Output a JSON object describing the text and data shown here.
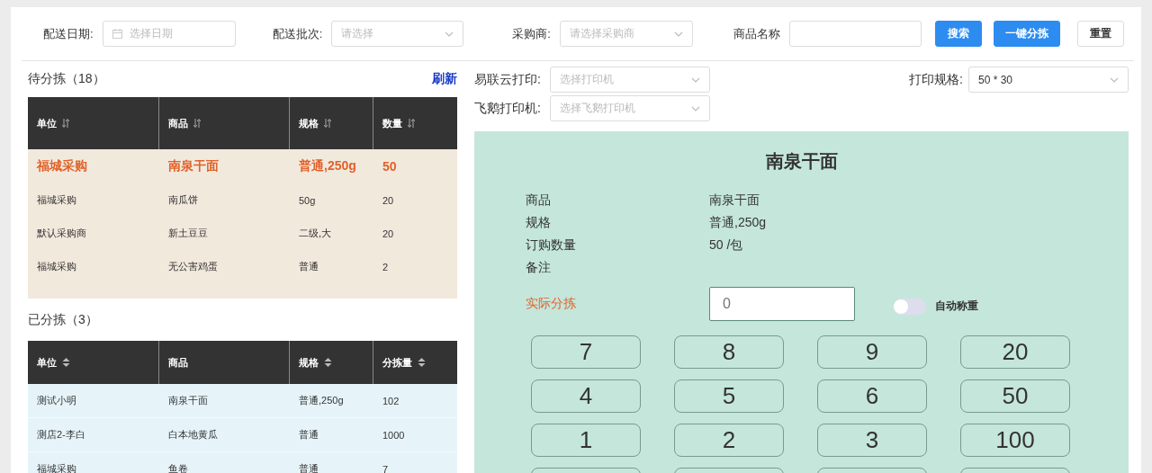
{
  "filters": [
    {
      "label": "配送日期:",
      "kind": "date",
      "placeholder": "选择日期"
    },
    {
      "label": "配送批次:",
      "kind": "select",
      "placeholder": "请选择"
    },
    {
      "label": "采购商:",
      "kind": "select",
      "placeholder": "请选择采购商"
    },
    {
      "label": "商品名称",
      "kind": "input"
    }
  ],
  "buttons": [
    {
      "label": "搜索",
      "kind": "primary"
    },
    {
      "label": "一键分拣",
      "kind": "primary"
    },
    {
      "label": "重置",
      "kind": "default"
    }
  ],
  "pending": {
    "title": "待分拣（18）",
    "refresh": "刷新",
    "columns": [
      {
        "label": "单位",
        "sortable": true
      },
      {
        "label": "商品",
        "sortable": true
      },
      {
        "label": "规格",
        "sortable": true
      },
      {
        "label": "数量",
        "sortable": true
      }
    ],
    "rows": [
      {
        "cells": [
          "福城采购",
          "南泉干面",
          "普通,250g",
          "50"
        ],
        "selected": true
      },
      {
        "cells": [
          "福城采购",
          "南瓜饼",
          "50g",
          "20"
        ],
        "selected": false
      },
      {
        "cells": [
          "默认采购商",
          "新土豆豆",
          "二级,大",
          "20"
        ],
        "selected": false
      },
      {
        "cells": [
          "福城采购",
          "无公害鸡蛋",
          "普通",
          "2"
        ],
        "selected": false
      }
    ]
  },
  "done": {
    "title": "已分拣（3）",
    "columns": [
      {
        "label": "单位",
        "sortable": true
      },
      {
        "label": "商品",
        "sortable": false
      },
      {
        "label": "规格",
        "sortable": true
      },
      {
        "label": "分拣量",
        "sortable": true
      }
    ],
    "rows": [
      {
        "cells": [
          "测试小明",
          "南泉干面",
          "普通,250g",
          "102"
        ]
      },
      {
        "cells": [
          "测店2-李白",
          "白本地黄瓜",
          "普通",
          "1000"
        ]
      },
      {
        "cells": [
          "福城采购",
          "鱼卷",
          "普通",
          "7"
        ]
      }
    ]
  },
  "printers": [
    {
      "label": "易联云打印:",
      "placeholder": "选择打印机"
    },
    {
      "label": "飞鹅打印机:",
      "placeholder": "选择飞鹅打印机"
    }
  ],
  "print_spec": {
    "label": "打印规格:",
    "value": "50 * 30"
  },
  "detail": {
    "title": "南泉干面",
    "fields": [
      {
        "label": "商品",
        "value": "南泉干面"
      },
      {
        "label": "规格",
        "value": "普通,250g"
      },
      {
        "label": "订购数量",
        "value": "50 /包"
      },
      {
        "label": "备注"
      }
    ],
    "actual": {
      "label": "实际分拣",
      "placeholder": "0"
    },
    "auto_weigh": {
      "label": "自动称重",
      "on": false
    },
    "keypad": [
      "7",
      "8",
      "9",
      "20",
      "4",
      "5",
      "6",
      "50",
      "1",
      "2",
      "3",
      "100"
    ]
  }
}
